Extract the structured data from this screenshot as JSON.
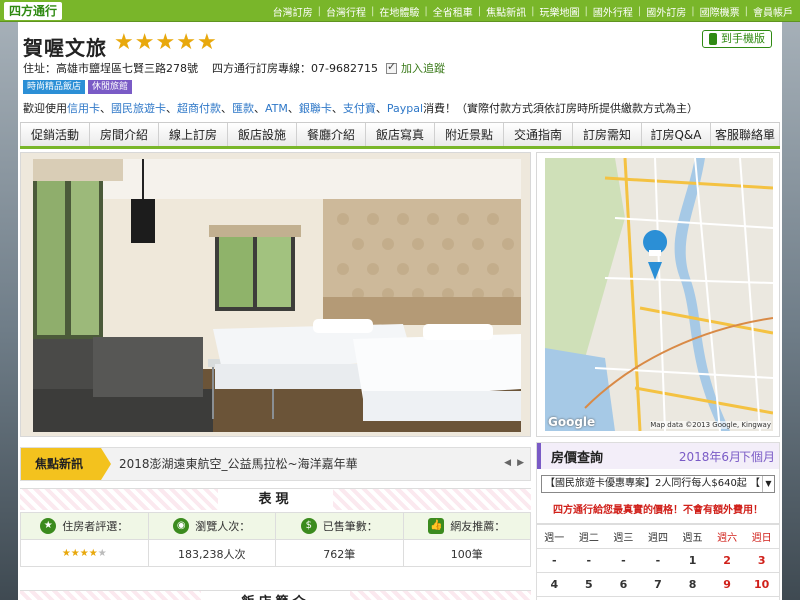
{
  "topbar": {
    "logo": "四方通行",
    "nav": [
      "台灣訂房",
      "台灣行程",
      "在地體驗",
      "全省租車",
      "焦點新訊",
      "玩樂地圖",
      "國外行程",
      "國外訂房",
      "國際機票",
      "會員帳戶"
    ]
  },
  "hotel": {
    "name": "賀喔文旅",
    "stars": 5,
    "address": "住址：高雄市鹽埕區七賢三路278號",
    "hotline": "四方通行訂房專線：07-9682715",
    "add_fav": "加入追蹤",
    "mobile": "到手機版"
  },
  "tags": [
    "時尚精品飯店",
    "休閒旅館"
  ],
  "payment": {
    "prefix": "歡迎使用",
    "methods": [
      "信用卡",
      "國民旅遊卡",
      "超商付款",
      "匯款",
      "ATM",
      "銀聯卡",
      "支付寶",
      "Paypal"
    ],
    "suffix": "消費！（實際付款方式須依訂房時所提供繳款方式為主）"
  },
  "tabs": [
    "促銷活動",
    "房間介紹",
    "線上訂房",
    "飯店設施",
    "餐廳介紹",
    "飯店寫真",
    "附近景點",
    "交通指南",
    "訂房需知",
    "訂房Q&A",
    "客服聯絡單"
  ],
  "map": {
    "labels": [
      "九如二路",
      "九如一路",
      "十全一路",
      "鐵道路",
      "元亨寺",
      "鼓山",
      "民族路",
      "河東路",
      "中華三路",
      "七賢二路",
      "大仁路",
      "苓雅區",
      "高雄忠烈祠",
      "大公路",
      "壽山",
      "壽山公園",
      "前金區",
      "市議會",
      "鹽埕埔站",
      "大義街",
      "五福三路",
      "光復路",
      "大順路",
      "高雄市立歷史博物館"
    ],
    "google": "Google",
    "copyright": "Map data ©2013 Google, Kingway"
  },
  "news": {
    "label": "焦點新訊",
    "text": "2018澎湖遠東航空_公益馬拉松~海洋嘉年華"
  },
  "performance": {
    "title": "表現",
    "items": [
      {
        "label": "住房者評選：",
        "value": "",
        "icon": "star-icon"
      },
      {
        "label": "瀏覽人次：",
        "value": "183,238人次",
        "icon": "eye-icon"
      },
      {
        "label": "已售筆數：",
        "value": "762筆",
        "icon": "dollar-icon"
      },
      {
        "label": "網友推薦：",
        "value": "100筆",
        "icon": "thumbs-up-icon"
      }
    ],
    "rating": 4.5
  },
  "intro": {
    "title": "飯店簡介"
  },
  "price": {
    "title": "房價查詢",
    "month": "2018年6月",
    "next": "下個月",
    "promo": "【國民旅遊卡優惠專案】2人同行每人$640起 【",
    "note": "四方通行給您最真實的價格！不會有額外費用！",
    "weekdays": [
      "週一",
      "週二",
      "週三",
      "週四",
      "週五",
      "週六",
      "週日"
    ],
    "weeks": [
      [
        "-",
        "-",
        "-",
        "-",
        "1",
        "2",
        "3"
      ],
      [
        "4",
        "5",
        "6",
        "7",
        "8",
        "9",
        "10"
      ]
    ]
  },
  "colors": {
    "brand_green": "#79b62a",
    "accent_purple": "#7a5bc6",
    "star": "#e8a80c",
    "red": "#d0201a"
  }
}
